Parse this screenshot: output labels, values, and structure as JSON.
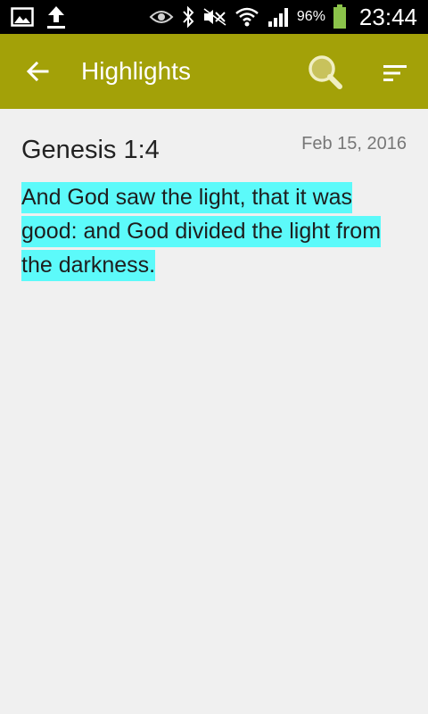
{
  "status_bar": {
    "battery_percent": "96%",
    "clock": "23:44",
    "icons": [
      "gallery-icon",
      "upload-icon",
      "eye-icon",
      "bluetooth-icon",
      "mute-icon",
      "wifi-icon",
      "signal-icon",
      "battery-icon"
    ],
    "battery_color": "#8bc34a"
  },
  "app_bar": {
    "title": "Highlights",
    "back_icon": "arrow-left-icon",
    "search_icon": "search-icon",
    "sort_icon": "sort-icon",
    "color": "#a3a108"
  },
  "highlights": [
    {
      "reference": "Genesis 1:4",
      "date": "Feb 15, 2016",
      "text": "And God saw the light, that it was good: and God divided the light from the darkness.",
      "highlight_color": "#5cfafa"
    }
  ]
}
